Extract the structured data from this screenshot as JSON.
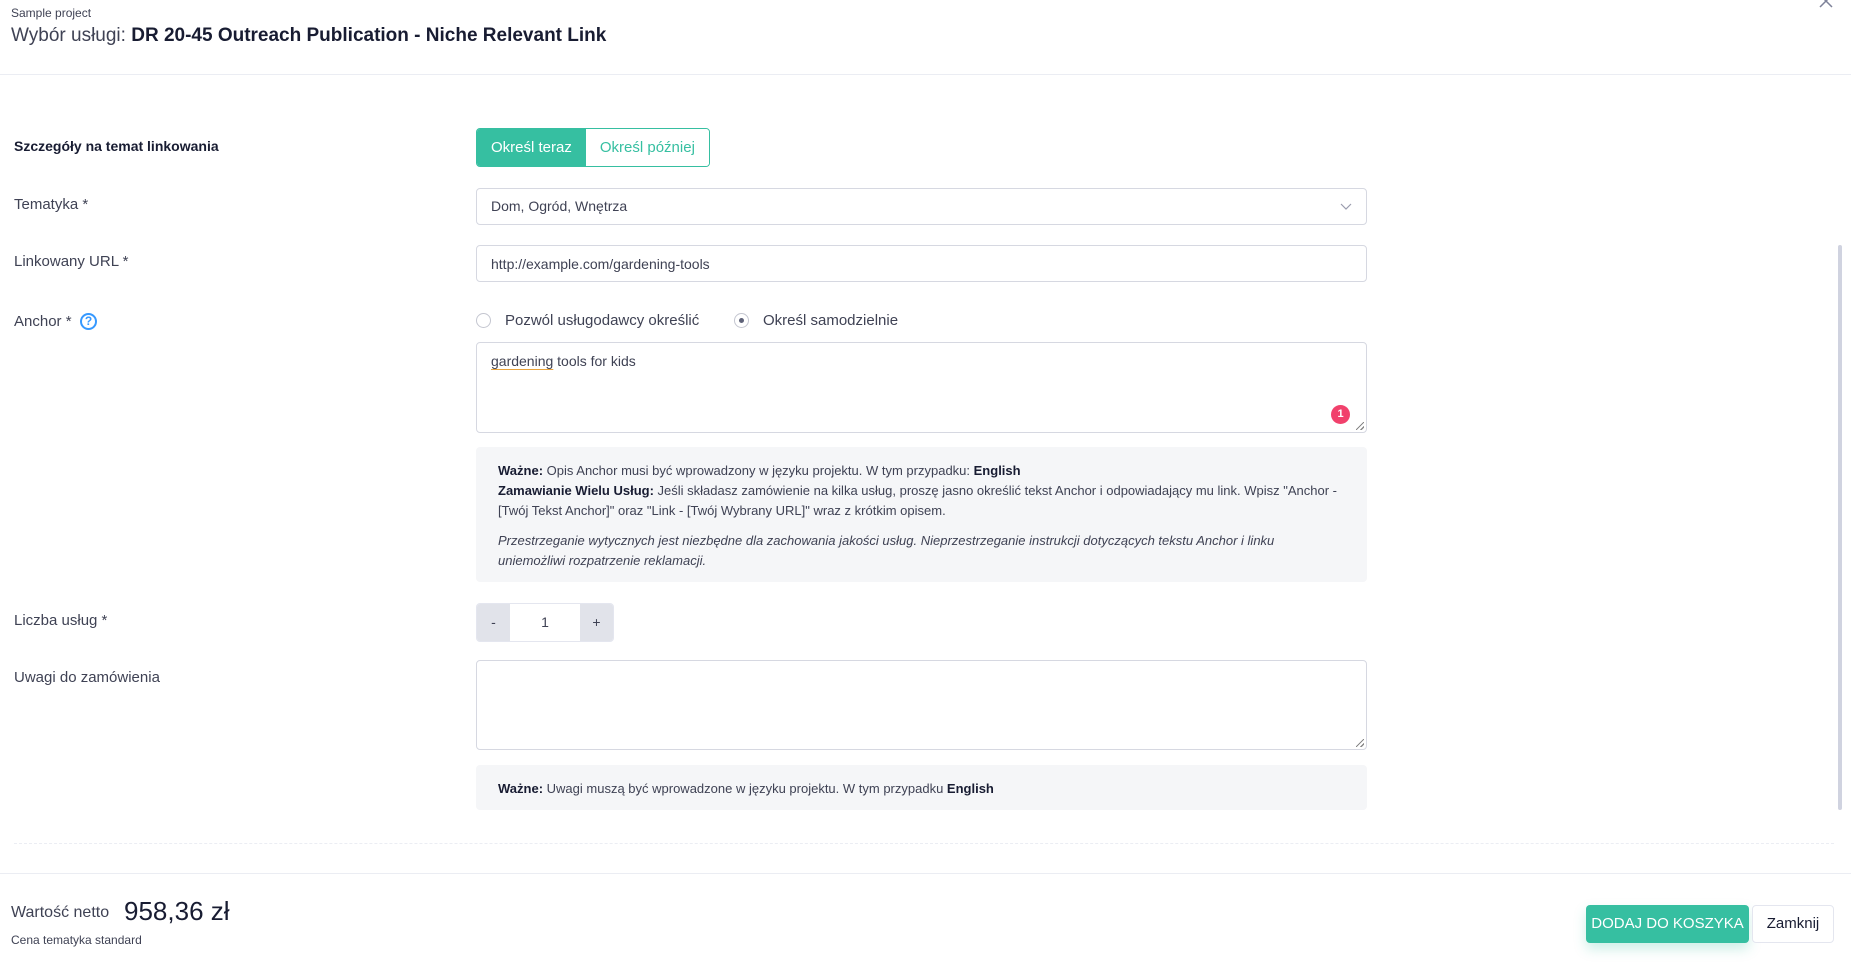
{
  "header": {
    "project": "Sample project",
    "title_prefix": "Wybór usługi:",
    "service_name": "DR 20-45 Outreach Publication - Niche Relevant Link",
    "close_icon": "close-icon"
  },
  "form": {
    "link_details": {
      "label": "Szczegóły na temat linkowania",
      "options": [
        "Określ teraz",
        "Określ później"
      ],
      "selected": "Określ teraz"
    },
    "topic": {
      "label": "Tematyka *",
      "value": "Dom, Ogród, Wnętrza"
    },
    "url": {
      "label": "Linkowany URL *",
      "value": "http://example.com/gardening-tools"
    },
    "anchor": {
      "label": "Anchor *",
      "help_icon": "?",
      "radio_options": [
        "Pozwól usługodawcy określić",
        "Określ samodzielnie"
      ],
      "selected": "Określ samodzielnie",
      "value_misspelled_word": "gardening",
      "value_rest": " tools for kids",
      "badge_count": "1"
    },
    "anchor_info": {
      "important_label": "Ważne:",
      "important_text": " Opis Anchor musi być wprowadzony w języku projektu. W tym przypadku: ",
      "language": "English",
      "multi_label": "Zamawianie Wielu Usług:",
      "multi_text": " Jeśli składasz zamówienie na kilka usług, proszę jasno określić tekst Anchor i odpowiadający mu link. Wpisz \"Anchor - [Twój Tekst Anchor]\" oraz \"Link - [Twój Wybrany URL]\" wraz z krótkim opisem.",
      "italic_note": "Przestrzeganie wytycznych jest niezbędne dla zachowania jakości usług. Nieprzestrzeganie instrukcji dotyczących tekstu Anchor i linku uniemożliwi rozpatrzenie reklamacji."
    },
    "quantity": {
      "label": "Liczba usług *",
      "minus": "-",
      "value": "1",
      "plus": "+"
    },
    "notes": {
      "label": "Uwagi do zamówienia",
      "value": ""
    },
    "notes_info": {
      "important_label": "Ważne:",
      "text": " Uwagi muszą być wprowadzone w języku projektu. W tym przypadku ",
      "language": "English"
    }
  },
  "footer": {
    "net_label": "Wartość netto",
    "net_value": "958,36 zł",
    "price_note": "Cena tematyka standard",
    "add_to_cart": "DODAJ DO KOSZYKA",
    "close": "Zamknij"
  },
  "colors": {
    "accent": "#36bfa1",
    "badge": "#f1416c",
    "help": "#3699ff"
  }
}
